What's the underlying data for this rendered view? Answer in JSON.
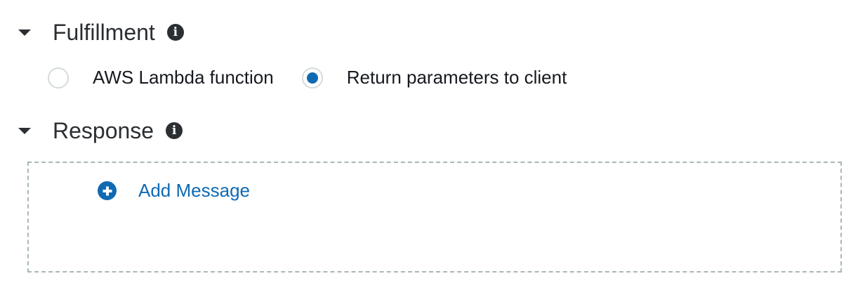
{
  "fulfillment": {
    "title": "Fulfillment",
    "info_icon": "info-icon",
    "options": [
      {
        "label": "AWS Lambda function",
        "selected": false
      },
      {
        "label": "Return parameters to client",
        "selected": true
      }
    ]
  },
  "response": {
    "title": "Response",
    "info_icon": "info-icon",
    "add_message_label": "Add Message",
    "add_message_icon": "plus-circle-icon"
  },
  "colors": {
    "accent": "#0f6ab4",
    "text": "#16191f",
    "header_text": "#2b2f33",
    "radio_border": "#d5dbdb",
    "dashed_border": "#aab7b8"
  }
}
